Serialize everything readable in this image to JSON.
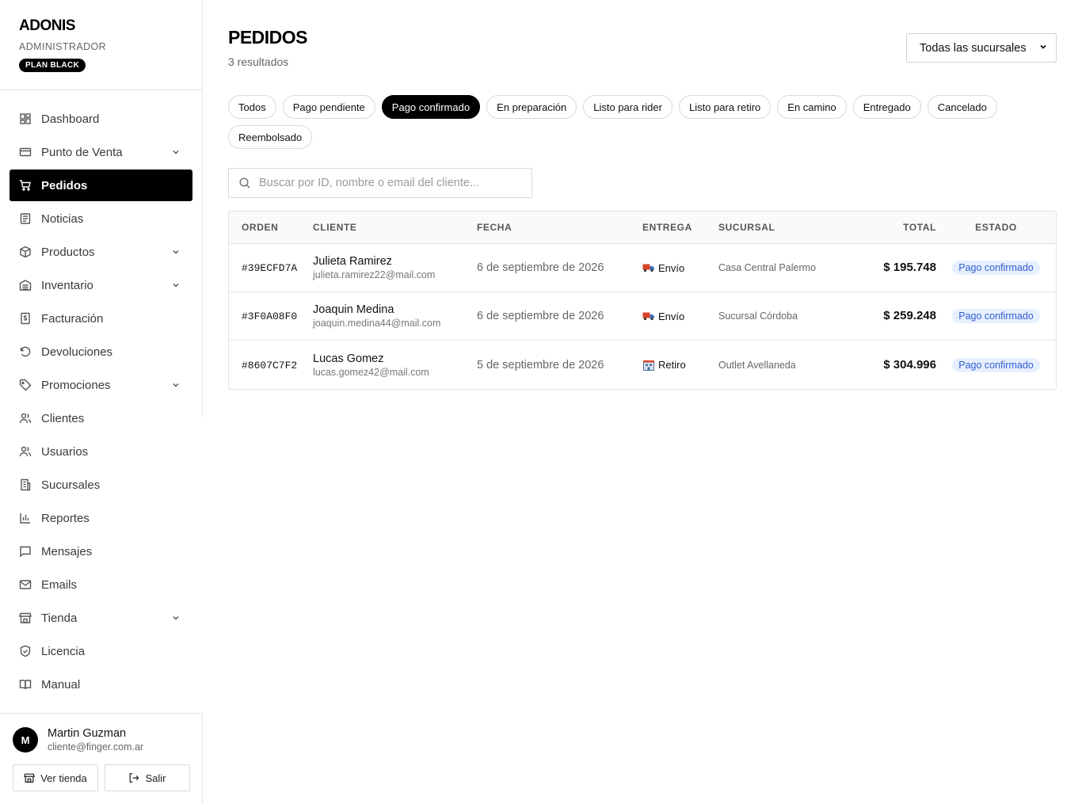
{
  "brand": {
    "name": "ADONIS",
    "role": "ADMINISTRADOR",
    "plan": "PLAN BLACK"
  },
  "nav": [
    {
      "label": "Dashboard",
      "icon": "dashboard-icon",
      "expandable": false
    },
    {
      "label": "Punto de Venta",
      "icon": "credit-card-icon",
      "expandable": true
    },
    {
      "label": "Pedidos",
      "icon": "cart-icon",
      "expandable": false,
      "active": true
    },
    {
      "label": "Noticias",
      "icon": "newspaper-icon",
      "expandable": false
    },
    {
      "label": "Productos",
      "icon": "box-icon",
      "expandable": true
    },
    {
      "label": "Inventario",
      "icon": "warehouse-icon",
      "expandable": true
    },
    {
      "label": "Facturación",
      "icon": "invoice-icon",
      "expandable": false
    },
    {
      "label": "Devoluciones",
      "icon": "undo-icon",
      "expandable": false
    },
    {
      "label": "Promociones",
      "icon": "tag-icon",
      "expandable": true
    },
    {
      "label": "Clientes",
      "icon": "users-icon",
      "expandable": false
    },
    {
      "label": "Usuarios",
      "icon": "users-icon",
      "expandable": false
    },
    {
      "label": "Sucursales",
      "icon": "building-icon",
      "expandable": false
    },
    {
      "label": "Reportes",
      "icon": "bar-chart-icon",
      "expandable": false
    },
    {
      "label": "Mensajes",
      "icon": "message-icon",
      "expandable": false
    },
    {
      "label": "Emails",
      "icon": "mail-icon",
      "expandable": false
    },
    {
      "label": "Tienda",
      "icon": "store-icon",
      "expandable": true
    },
    {
      "label": "Licencia",
      "icon": "shield-icon",
      "expandable": false
    },
    {
      "label": "Manual",
      "icon": "book-icon",
      "expandable": false
    }
  ],
  "user": {
    "initial": "M",
    "name": "Martin Guzman",
    "email": "cliente@finger.com.ar",
    "view_store": "Ver tienda",
    "logout": "Salir"
  },
  "page": {
    "title": "PEDIDOS",
    "results": "3 resultados",
    "branch_select": "Todas las sucursales"
  },
  "filters": [
    {
      "label": "Todos"
    },
    {
      "label": "Pago pendiente"
    },
    {
      "label": "Pago confirmado",
      "active": true
    },
    {
      "label": "En preparación"
    },
    {
      "label": "Listo para rider"
    },
    {
      "label": "Listo para retiro"
    },
    {
      "label": "En camino"
    },
    {
      "label": "Entregado"
    },
    {
      "label": "Cancelado"
    },
    {
      "label": "Reembolsado"
    }
  ],
  "search": {
    "placeholder": "Buscar por ID, nombre o email del cliente..."
  },
  "table": {
    "headers": {
      "orden": "ORDEN",
      "cliente": "CLIENTE",
      "fecha": "FECHA",
      "entrega": "ENTREGA",
      "sucursal": "SUCURSAL",
      "total": "TOTAL",
      "estado": "ESTADO"
    },
    "rows": [
      {
        "id": "#39ECFD7A",
        "name": "Julieta Ramirez",
        "email": "julieta.ramirez22@mail.com",
        "date": "6 de septiembre de 2026",
        "delivery": "Envío",
        "delivery_icon": "truck-icon",
        "branch": "Casa Central Palermo",
        "total": "$ 195.748",
        "status": "Pago confirmado"
      },
      {
        "id": "#3F0A08F0",
        "name": "Joaquin Medina",
        "email": "joaquin.medina44@mail.com",
        "date": "6 de septiembre de 2026",
        "delivery": "Envío",
        "delivery_icon": "truck-icon",
        "branch": "Sucursal Córdoba",
        "total": "$ 259.248",
        "status": "Pago confirmado"
      },
      {
        "id": "#8607C7F2",
        "name": "Lucas Gomez",
        "email": "lucas.gomez42@mail.com",
        "date": "5 de septiembre de 2026",
        "delivery": "Retiro",
        "delivery_icon": "store-pickup-icon",
        "branch": "Outlet Avellaneda",
        "total": "$ 304.996",
        "status": "Pago confirmado"
      }
    ]
  },
  "colors": {
    "accent": "#000000",
    "status_bg": "#e7efff",
    "status_text": "#2f5fd0"
  }
}
